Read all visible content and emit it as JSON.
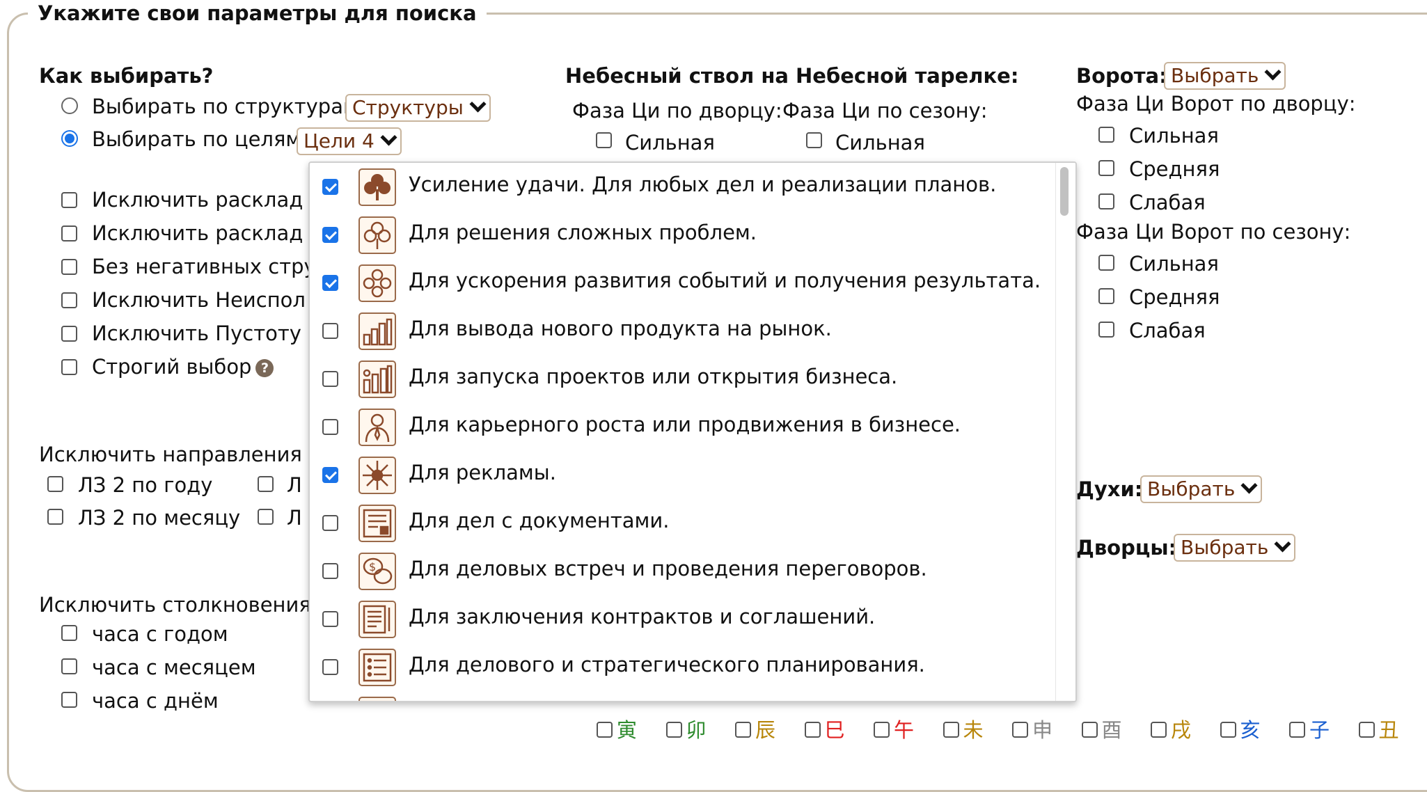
{
  "section_title": "Укажите свои параметры для поиска",
  "how": {
    "title": "Как выбирать?",
    "by_structures": {
      "label": "Выбирать по структурам",
      "select": "Структуры"
    },
    "by_goals": {
      "label": "Выбирать по целям",
      "select": "Цели 4"
    }
  },
  "options": [
    "Исключить расклад",
    "Исключить расклад",
    "Без негативных стру",
    "Исключить Неиспол",
    "Исключить Пустоту",
    "Строгий выбор"
  ],
  "help_icon_glyph": "?",
  "exclude_directions": {
    "title": "Исключить направления",
    "items": [
      "ЛЗ 2 по году",
      "ЛЗ 2 по месяцу"
    ],
    "cut_items": [
      "Л",
      "Л"
    ]
  },
  "exclude_collisions": {
    "title": "Исключить столкновения",
    "items": [
      "часа с годом",
      "часа с месяцем",
      "часа с днём"
    ]
  },
  "heavenly": {
    "title": "Небесный ствол на Небесной тарелке:",
    "palace_phase": "Фаза Ци по дворцу:",
    "season_phase": "Фаза Ци по сезону:",
    "strong": "Сильная"
  },
  "gates": {
    "label": "Ворота:",
    "select": "Выбрать",
    "palace_phase": "Фаза Ци Ворот по дворцу:",
    "season_phase": "Фаза Ци Ворот по сезону:",
    "levels": [
      "Сильная",
      "Средняя",
      "Слабая"
    ]
  },
  "spirits": {
    "label": "Духи:",
    "select": "Выбрать"
  },
  "palaces": {
    "label": "Дворцы:",
    "select": "Выбрать"
  },
  "goals": [
    {
      "label": "Усиление удачи. Для любых дел и реализации планов.",
      "checked": true,
      "icon": "clover-solid-icon"
    },
    {
      "label": "Для решения сложных проблем.",
      "checked": true,
      "icon": "clover-outline-icon"
    },
    {
      "label": "Для ускорения развития событий и получения результата.",
      "checked": true,
      "icon": "clover-cross-icon"
    },
    {
      "label": "Для вывода нового продукта на рынок.",
      "checked": false,
      "icon": "bar-growth-icon"
    },
    {
      "label": "Для запуска проектов или открытия бизнеса.",
      "checked": false,
      "icon": "bar-rising-icon"
    },
    {
      "label": "Для карьерного роста или продвижения в бизнесе.",
      "checked": false,
      "icon": "person-icon"
    },
    {
      "label": "Для рекламы.",
      "checked": true,
      "icon": "burst-icon"
    },
    {
      "label": "Для дел с документами.",
      "checked": false,
      "icon": "document-icon"
    },
    {
      "label": "Для деловых встреч и проведения переговоров.",
      "checked": false,
      "icon": "chat-money-icon"
    },
    {
      "label": "Для заключения контрактов и соглашений.",
      "checked": false,
      "icon": "contract-pen-icon"
    },
    {
      "label": "Для делового и стратегического планирования.",
      "checked": false,
      "icon": "list-icon"
    }
  ],
  "branches": [
    {
      "char": "寅",
      "color": "#2e8b2e"
    },
    {
      "char": "卯",
      "color": "#2e8b2e"
    },
    {
      "char": "辰",
      "color": "#b8860b"
    },
    {
      "char": "巳",
      "color": "#e02020"
    },
    {
      "char": "午",
      "color": "#e02020"
    },
    {
      "char": "未",
      "color": "#b8860b"
    },
    {
      "char": "申",
      "color": "#888888"
    },
    {
      "char": "酉",
      "color": "#888888"
    },
    {
      "char": "戌",
      "color": "#b8860b"
    },
    {
      "char": "亥",
      "color": "#1a5fd0"
    },
    {
      "char": "子",
      "color": "#1a5fd0"
    },
    {
      "char": "丑",
      "color": "#b8860b"
    }
  ],
  "colors": {
    "accent": "#1a73e8",
    "select_text": "#6b2f0f",
    "icon_brown": "#8b4a2b"
  }
}
